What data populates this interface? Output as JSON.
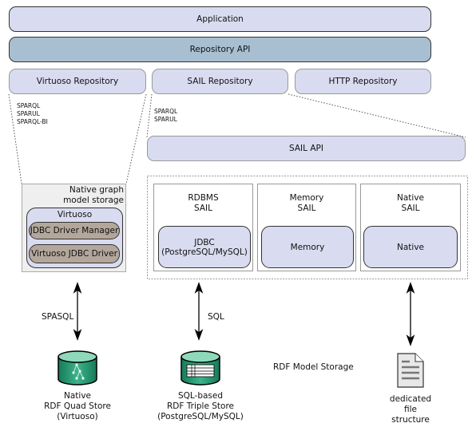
{
  "layers": {
    "application": "Application",
    "repository_api": "Repository API",
    "virtuoso_repository": "Virtuoso Repository",
    "sail_repository": "SAIL Repository",
    "http_repository": "HTTP Repository",
    "sail_api": "SAIL API"
  },
  "virtuoso_protocols": [
    "SPARQL",
    "SPARUL",
    "SPARQL-BI"
  ],
  "sail_protocols": [
    "SPARQL",
    "SPARUL"
  ],
  "native_storage": {
    "title_line1": "Native graph",
    "title_line2": "model storage",
    "virtuoso": "Virtuoso",
    "jdbc_manager": "JDBC Driver Manager",
    "jdbc_driver": "Virtuoso JDBC Driver"
  },
  "sails": [
    {
      "line1": "RDBMS",
      "line2": "SAIL",
      "inner1": "JDBC",
      "inner2": "(PostgreSQL/MySQL)"
    },
    {
      "line1": "Memory",
      "line2": "SAIL",
      "inner1": "Memory",
      "inner2": ""
    },
    {
      "line1": "Native",
      "line2": "SAIL",
      "inner1": "Native",
      "inner2": ""
    }
  ],
  "connections": {
    "spasql": "SPASQL",
    "sql": "SQL"
  },
  "storage_label": "RDF Model Storage",
  "stores": {
    "quad": [
      "Native",
      "RDF Quad Store",
      "(Virtuoso)"
    ],
    "triple": [
      "SQL-based",
      "RDF Triple Store",
      "(PostgreSQL/MySQL)"
    ],
    "file": [
      "dedicated",
      "file",
      "structure"
    ]
  },
  "colors": {
    "lavender": "#d9dcf0",
    "api_blue": "#a8bfd1",
    "brown": "#b3a79b",
    "db_green": "#1f8f6a"
  }
}
